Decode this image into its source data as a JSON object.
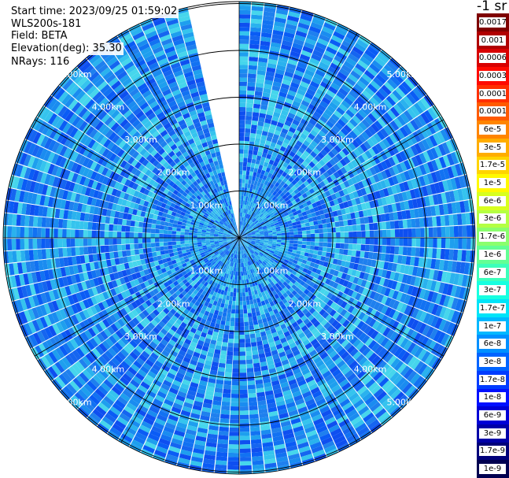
{
  "header": {
    "start_time": "Start time: 2023/09/25 01:59:02",
    "instrument": "WLS200s-181",
    "field": "Field: BETA",
    "elevation": "Elevation(deg): 35.30",
    "nrays": "NRays: 116"
  },
  "colorbar": {
    "unit_label": "-1 sr",
    "tick_labels": [
      "0.0017",
      "0.001",
      "0.0006",
      "0.0003",
      "0.00017",
      "0.0001",
      "6e-5",
      "3e-5",
      "1.7e-5",
      "1e-5",
      "6e-6",
      "3e-6",
      "1.7e-6",
      "1e-6",
      "6e-7",
      "3e-7",
      "1.7e-7",
      "1e-7",
      "6e-8",
      "3e-8",
      "1.7e-8",
      "1e-8",
      "6e-9",
      "3e-9",
      "1.7e-9",
      "1e-9"
    ],
    "colors": [
      "#7f0000",
      "#b00000",
      "#d80000",
      "#ff0a00",
      "#ff2f00",
      "#ff5a00",
      "#ff8500",
      "#ffad00",
      "#ffd400",
      "#fff900",
      "#d8ff1f",
      "#b4ff43",
      "#8aff6d",
      "#63ff94",
      "#3dffbb",
      "#17ffe0",
      "#00e4f8",
      "#00b8ff",
      "#0090ff",
      "#0064ff",
      "#003cff",
      "#0010ff",
      "#0000d6",
      "#0000a8",
      "#00007a",
      "#000050"
    ]
  },
  "chart_data": {
    "type": "heatmap",
    "projection": "polar (PPI scan)",
    "field": "BETA",
    "elevation_deg": 35.3,
    "n_rays": 116,
    "colorscale": "log",
    "range_rings_km": [
      1.0,
      2.0,
      3.0,
      4.0,
      5.0
    ],
    "ring_labels": [
      "1.00km",
      "2.00km",
      "3.00km",
      "4.00km",
      "5.00km"
    ],
    "dominant_value_range": [
      1e-08,
      1e-07
    ],
    "missing_sector_azimuth_deg": [
      345,
      360
    ],
    "grid": true
  }
}
